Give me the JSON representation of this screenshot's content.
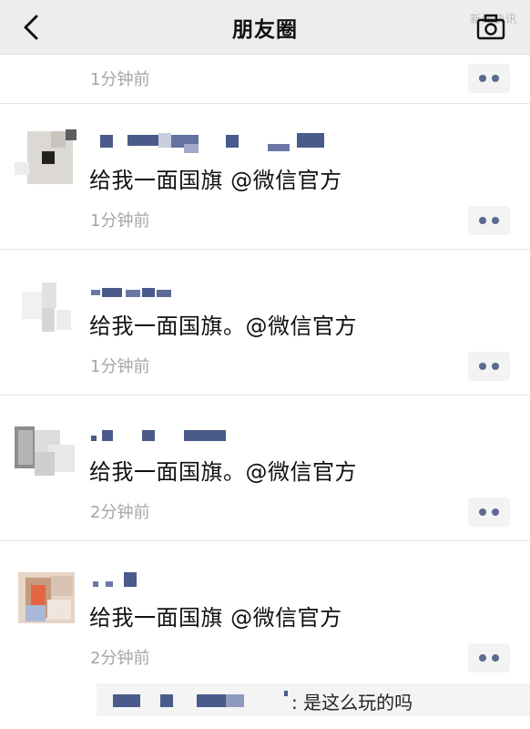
{
  "header": {
    "title": "朋友圈",
    "watermark": "新闻快讯"
  },
  "first_row": {
    "time": "1分钟前"
  },
  "posts": [
    {
      "content": "给我一面国旗 @微信官方",
      "time": "1分钟前"
    },
    {
      "content": "给我一面国旗。@微信官方",
      "time": "1分钟前"
    },
    {
      "content": "给我一面国旗。@微信官方",
      "time": "2分钟前"
    },
    {
      "content": "给我一面国旗 @微信官方",
      "time": "2分钟前"
    }
  ],
  "comment": {
    "text": ": 是这么玩的吗"
  },
  "icons": {
    "back": "chevron-left-icon",
    "camera": "camera-icon",
    "more": "more-dots-icon"
  },
  "colors": {
    "link_blue": "#5b6a92",
    "time_gray": "#a6a6a6",
    "header_bg": "#ededed"
  }
}
